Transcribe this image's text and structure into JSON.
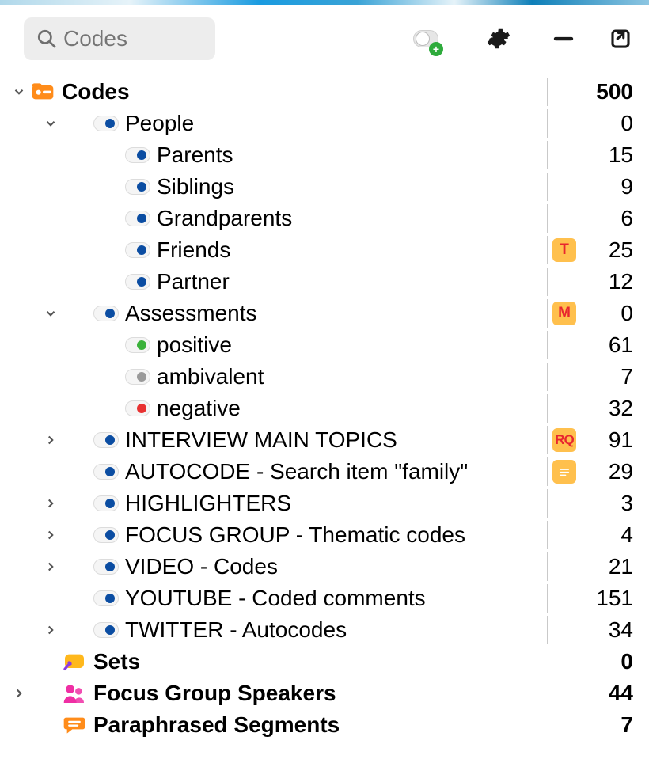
{
  "toolbar": {
    "search_placeholder": "Codes"
  },
  "root": {
    "label": "Codes",
    "count": 500
  },
  "people": {
    "label": "People",
    "count": 0,
    "children": [
      {
        "label": "Parents",
        "count": 15,
        "color": "#0b4da2"
      },
      {
        "label": "Siblings",
        "count": 9,
        "color": "#0b4da2"
      },
      {
        "label": "Grandparents",
        "count": 6,
        "color": "#0b4da2"
      },
      {
        "label": "Friends",
        "count": 25,
        "color": "#0b4da2",
        "badge": "T"
      },
      {
        "label": "Partner",
        "count": 12,
        "color": "#0b4da2"
      }
    ]
  },
  "assessments": {
    "label": "Assessments",
    "count": 0,
    "badge": "M",
    "children": [
      {
        "label": "positive",
        "count": 61,
        "color": "#3bb23b"
      },
      {
        "label": "ambivalent",
        "count": 7,
        "color": "#9a9a9a"
      },
      {
        "label": "negative",
        "count": 32,
        "color": "#e83131"
      }
    ]
  },
  "main_items": [
    {
      "label": "INTERVIEW MAIN TOPICS",
      "count": 91,
      "caret": true,
      "badge": "RQ"
    },
    {
      "label": "AUTOCODE - Search item \"family\"",
      "count": 29,
      "caret": false,
      "badge": "memo"
    },
    {
      "label": "HIGHLIGHTERS",
      "count": 3,
      "caret": true
    },
    {
      "label": "FOCUS GROUP - Thematic codes",
      "count": 4,
      "caret": true
    },
    {
      "label": "VIDEO - Codes",
      "count": 21,
      "caret": true
    },
    {
      "label": "YOUTUBE - Coded comments",
      "count": 151,
      "caret": false
    },
    {
      "label": "TWITTER - Autocodes",
      "count": 34,
      "caret": true
    }
  ],
  "sets": {
    "label": "Sets",
    "count": 0
  },
  "focus_group": {
    "label": "Focus Group Speakers",
    "count": 44
  },
  "paraphrased": {
    "label": "Paraphrased Segments",
    "count": 7
  }
}
